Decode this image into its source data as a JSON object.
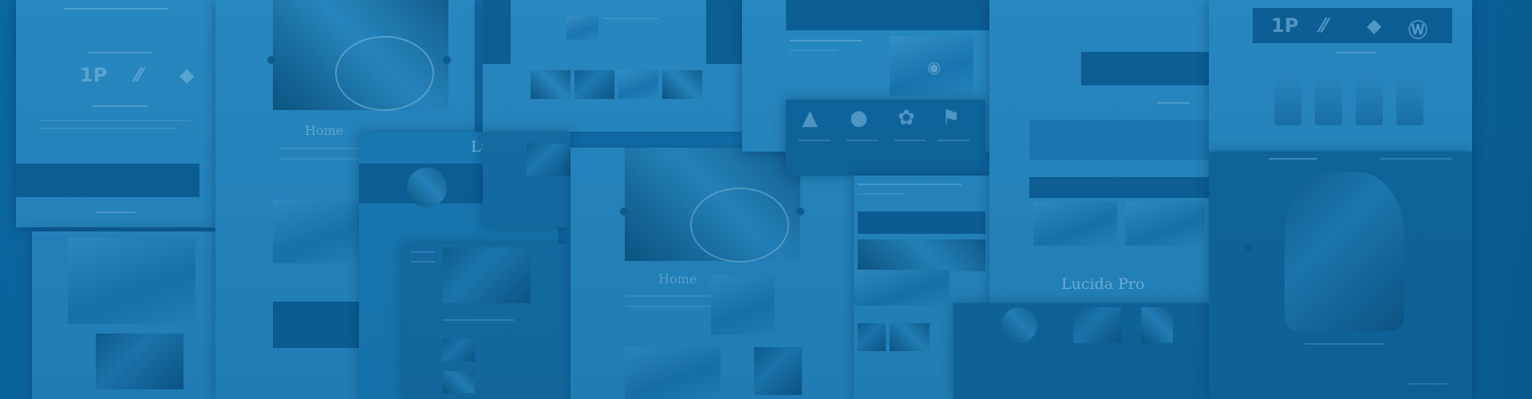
{
  "background": {
    "overlay_color": "#0a6aa3",
    "card_color": "#1d82bb",
    "dark_card_color": "#0f679d"
  },
  "headings": {
    "mosaic_1": "Home",
    "mosaic_2": "Lucid",
    "mosaic_3": "Home",
    "mosaic_4": "Lucida Pro"
  },
  "icons": [
    "brand-logo-icon",
    "feather-icon",
    "diamond-icon",
    "wordpress-icon",
    "graduation-cap-icon",
    "user-icon",
    "award-ribbon-icon",
    "map-pin-icon",
    "camera-icon"
  ]
}
